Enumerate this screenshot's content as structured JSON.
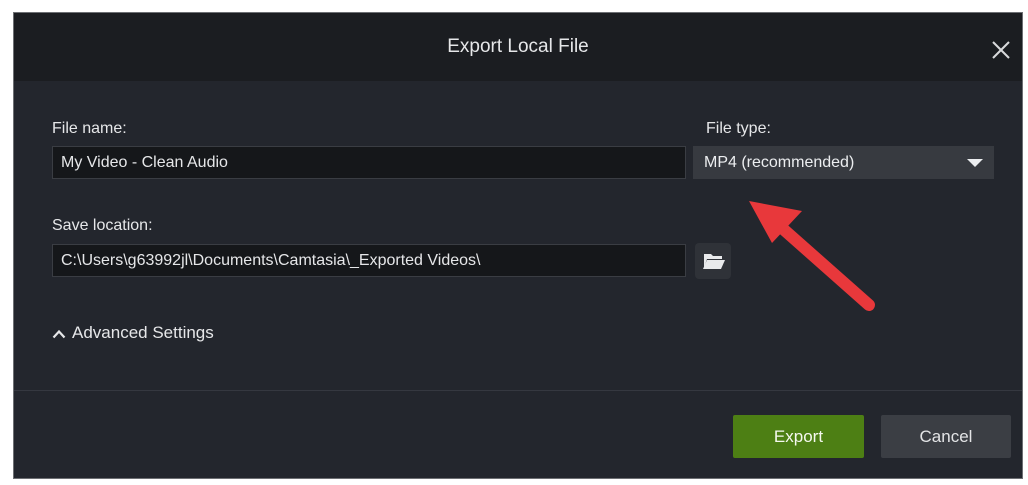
{
  "dialog": {
    "title": "Export Local File"
  },
  "file_name": {
    "label": "File name:",
    "value": "My Video - Clean Audio"
  },
  "file_type": {
    "label": "File type:",
    "selected": "MP4 (recommended)"
  },
  "save_location": {
    "label": "Save location:",
    "value": "C:\\Users\\g63992jl\\Documents\\Camtasia\\_Exported Videos\\"
  },
  "advanced": {
    "label": "Advanced Settings"
  },
  "buttons": {
    "export": "Export",
    "cancel": "Cancel"
  },
  "icons": {
    "close": "close-icon",
    "folder": "folder-open-icon",
    "chevron": "chevron-up-icon",
    "caret": "caret-down-icon"
  },
  "colors": {
    "export_button": "#4d7f14",
    "annotation_arrow": "#e8383b"
  }
}
